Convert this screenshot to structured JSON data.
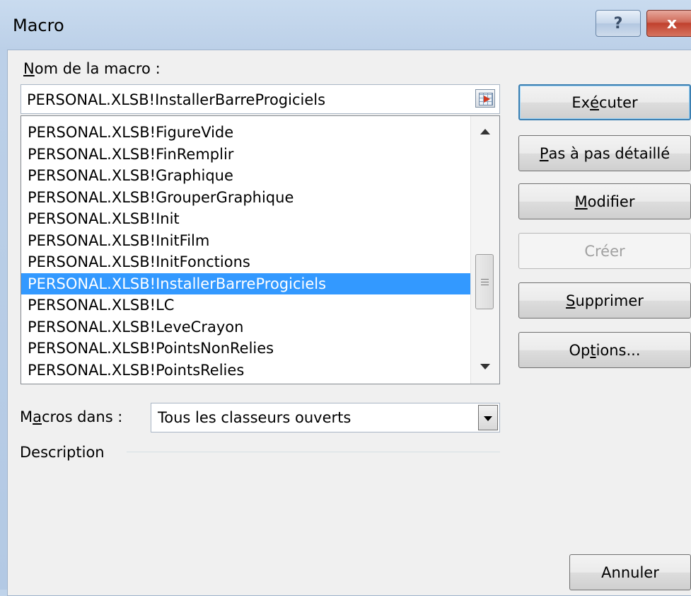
{
  "window": {
    "title": "Macro",
    "help_label": "?",
    "close_label": "x"
  },
  "macro_name": {
    "label_prefix": "",
    "label_mnemonic": "N",
    "label_rest": "om de la macro :",
    "value": "PERSONAL.XLSB!InstallerBarreProgiciels"
  },
  "macro_list": {
    "items": [
      "PERSONAL.XLSB!FigureVide",
      "PERSONAL.XLSB!FinRemplir",
      "PERSONAL.XLSB!Graphique",
      "PERSONAL.XLSB!GrouperGraphique",
      "PERSONAL.XLSB!Init",
      "PERSONAL.XLSB!InitFilm",
      "PERSONAL.XLSB!InitFonctions",
      "PERSONAL.XLSB!InstallerBarreProgiciels",
      "PERSONAL.XLSB!LC",
      "PERSONAL.XLSB!LeveCrayon",
      "PERSONAL.XLSB!PointsNonRelies",
      "PERSONAL.XLSB!PointsRelies"
    ],
    "selected_index": 7
  },
  "buttons": {
    "executer": {
      "pre": "Ex",
      "mn": "é",
      "post": "cuter"
    },
    "pas_a_pas": {
      "pre": "",
      "mn": "P",
      "post": "as à pas détaillé"
    },
    "modifier": {
      "pre": "",
      "mn": "M",
      "post": "odifier"
    },
    "creer": {
      "label": "Créer"
    },
    "supprimer": {
      "pre": "",
      "mn": "S",
      "post": "upprimer"
    },
    "options": {
      "pre": "Op",
      "mn": "t",
      "post": "ions..."
    },
    "annuler": {
      "label": "Annuler"
    }
  },
  "macros_dans": {
    "label_pre": "M",
    "label_mn": "a",
    "label_post": "cros dans :",
    "value": "Tous les classeurs ouverts"
  },
  "description": {
    "label": "Description"
  }
}
